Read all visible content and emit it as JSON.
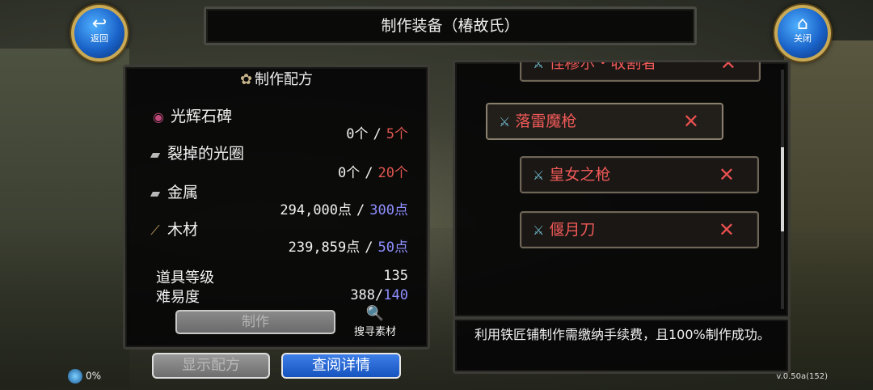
{
  "title": "制作装备（椿故氏）",
  "nav": {
    "back_label": "返回",
    "back_icon": "back-arrow-icon",
    "close_label": "关闭",
    "close_icon": "home-icon"
  },
  "recipe": {
    "title": "制作配方",
    "materials": [
      {
        "name": "光辉石碑",
        "icon": "orb-icon",
        "have": "0个",
        "need": "5个",
        "need_color": "#e0564f"
      },
      {
        "name": "裂掉的光圈",
        "icon": "metal-bar-icon",
        "have": "0个",
        "need": "20个",
        "need_color": "#e0564f"
      },
      {
        "name": "金属",
        "icon": "metal-bar-icon",
        "have": "294,000点",
        "need": "300点",
        "need_color": "#8f8fff"
      },
      {
        "name": "木材",
        "icon": "wood-icon",
        "have": "239,859点",
        "need": "50点",
        "need_color": "#8f8fff"
      }
    ],
    "item_level_label": "道具等级",
    "item_level_value": "135",
    "difficulty_label": "难易度",
    "difficulty_value": "388",
    "difficulty_max": "140",
    "make_label": "制作",
    "search_label": "搜寻素材"
  },
  "buttons": {
    "show_recipe": "显示配方",
    "view_detail": "查阅详情"
  },
  "list": {
    "items": [
      {
        "name": "怪穆尔・收割者"
      },
      {
        "name": "落雷魔枪"
      },
      {
        "name": "皇女之枪"
      },
      {
        "name": "偃月刀"
      }
    ]
  },
  "description": "利用铁匠铺制作需缴纳手续费，且100%制作成功。",
  "status": {
    "percent": "0%"
  },
  "version": "v.0.50a(152)"
}
